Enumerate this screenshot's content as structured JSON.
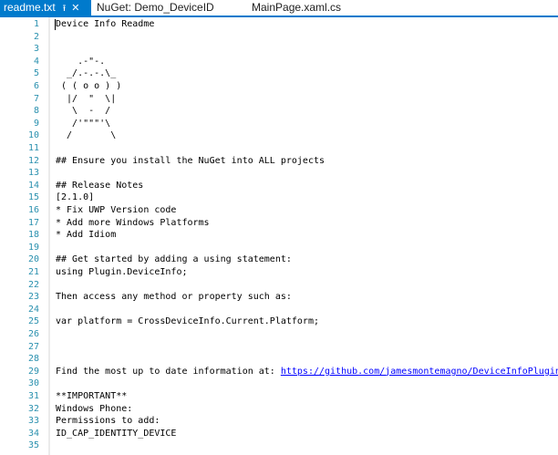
{
  "tabs": [
    {
      "label": "readme.txt",
      "active": true
    },
    {
      "label": "NuGet: Demo_DeviceID",
      "active": false
    },
    {
      "label": "MainPage.xaml.cs",
      "active": false
    }
  ],
  "icons": {
    "pin": "pin-icon",
    "close": "close-icon"
  },
  "colors": {
    "accent": "#007acc",
    "line_number": "#2b91af",
    "link": "#0000ff"
  },
  "editor": {
    "lines": [
      {
        "n": "1",
        "text": "Device Info Readme"
      },
      {
        "n": "2",
        "text": ""
      },
      {
        "n": "3",
        "text": ""
      },
      {
        "n": "4",
        "text": "    .-\"-."
      },
      {
        "n": "5",
        "text": "  _/.-.-.\\_"
      },
      {
        "n": "6",
        "text": " ( ( o o ) )"
      },
      {
        "n": "7",
        "text": "  |/  \"  \\|"
      },
      {
        "n": "8",
        "text": "   \\  -  /"
      },
      {
        "n": "9",
        "text": "   /'\"\"\"'\\"
      },
      {
        "n": "10",
        "text": "  /       \\"
      },
      {
        "n": "11",
        "text": ""
      },
      {
        "n": "12",
        "text": "## Ensure you install the NuGet into ALL projects"
      },
      {
        "n": "13",
        "text": ""
      },
      {
        "n": "14",
        "text": "## Release Notes"
      },
      {
        "n": "15",
        "text": "[2.1.0]"
      },
      {
        "n": "16",
        "text": "* Fix UWP Version code"
      },
      {
        "n": "17",
        "text": "* Add more Windows Platforms"
      },
      {
        "n": "18",
        "text": "* Add Idiom"
      },
      {
        "n": "19",
        "text": ""
      },
      {
        "n": "20",
        "text": "## Get started by adding a using statement:"
      },
      {
        "n": "21",
        "text": "using Plugin.DeviceInfo;"
      },
      {
        "n": "22",
        "text": ""
      },
      {
        "n": "23",
        "text": "Then access any method or property such as:"
      },
      {
        "n": "24",
        "text": ""
      },
      {
        "n": "25",
        "text": "var platform = CrossDeviceInfo.Current.Platform;"
      },
      {
        "n": "26",
        "text": ""
      },
      {
        "n": "27",
        "text": ""
      },
      {
        "n": "28",
        "text": ""
      },
      {
        "n": "29",
        "text": "Find the most up to date information at: ",
        "link": "https://github.com/jamesmontemagno/DeviceInfoPlugin"
      },
      {
        "n": "30",
        "text": ""
      },
      {
        "n": "31",
        "text": "**IMPORTANT**"
      },
      {
        "n": "32",
        "text": "Windows Phone:"
      },
      {
        "n": "33",
        "text": "Permissions to add:"
      },
      {
        "n": "34",
        "text": "ID_CAP_IDENTITY_DEVICE"
      },
      {
        "n": "35",
        "text": ""
      }
    ]
  }
}
